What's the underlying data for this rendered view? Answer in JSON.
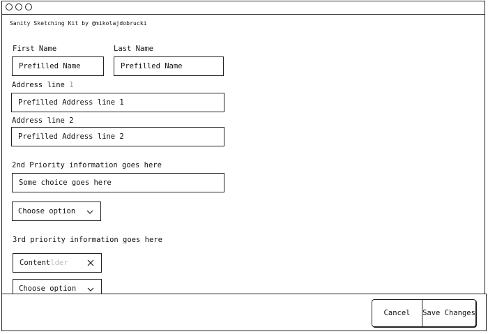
{
  "app": {
    "credit": "Sanity Sketching Kit by @mikolajdobrucki"
  },
  "form": {
    "first_name": {
      "label": "First Name",
      "value": "Prefilled Name"
    },
    "last_name": {
      "label": "Last Name",
      "value": "Prefilled Name"
    },
    "address1": {
      "label": "Address line",
      "label_suffix": "1",
      "value": "Prefilled Address line 1"
    },
    "address2": {
      "label": "Address line 2",
      "value": "Prefilled Address line 2"
    },
    "second_priority": {
      "label": "2nd Priority information goes here",
      "value": "Some choice goes here",
      "select_label": "Choose option"
    },
    "third_priority": {
      "label": "3rd priority information goes here",
      "tag_value": "Content",
      "tag_placeholder_fragment": "lder",
      "select_label": "Choose option"
    }
  },
  "footer": {
    "cancel_label": "Cancel",
    "save_label": "Save Changes"
  },
  "icons": {
    "window_controls": [
      "window-dot-icon",
      "window-dot-icon",
      "window-dot-icon"
    ],
    "chevron": "chevron-down-icon",
    "clear": "close-icon"
  }
}
